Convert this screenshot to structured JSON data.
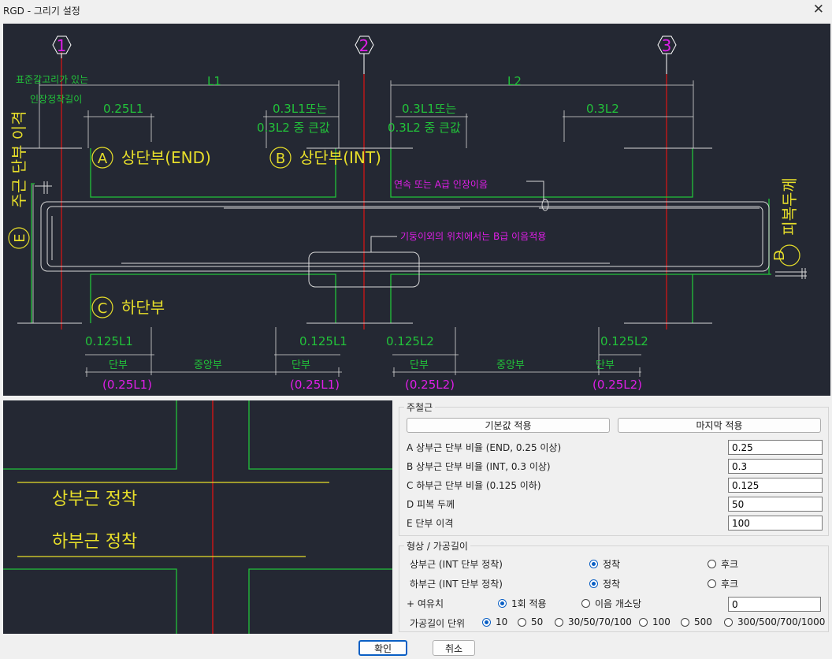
{
  "window": {
    "title": "RGD - 그리기 설정",
    "close_glyph": "✕"
  },
  "top_diagram": {
    "gridlines": [
      "1",
      "2",
      "3"
    ],
    "note_hook_1": "표준갈고리가 있는",
    "note_hook_2": "인장정착길이",
    "span_1": "L1",
    "span_2": "L2",
    "dim_025L1": "0.25L1",
    "dim_03L1_or": "0.3L1또는",
    "dim_03L2_larger": "0.3L2 중 큰값",
    "dim_03L1_or_b": "0.3L1또는",
    "dim_03L2_larger_b": "0.3L2 중 큰값",
    "dim_03L2": "0.3L2",
    "label_A_letter": "A",
    "label_A": "상단부(END)",
    "label_B_letter": "B",
    "label_B": "상단부(INT)",
    "label_C_letter": "C",
    "label_C": "하단부",
    "label_D_letter": "D",
    "label_D": "피복두께",
    "label_E_letter": "E",
    "label_E": "주근 단부 이격",
    "splice_note_1": "연속 또는 A급 인장이음",
    "splice_note_2": "기둥이외의 위치에서는 B급 이음적용",
    "bottom_dims": [
      "0.125L1",
      "0.125L1",
      "0.125L2",
      "0.125L2"
    ],
    "zone_end": "단부",
    "zone_center": "중앙부",
    "paren_dims": [
      "(0.25L1)",
      "(0.25L1)",
      "(0.25L2)",
      "(0.25L2)"
    ]
  },
  "bottom_diagram": {
    "top_anchor": "상부근 정착",
    "bottom_anchor": "하부근 정착"
  },
  "main_bar": {
    "legend": "주철근",
    "btn_default": "기본값 적용",
    "btn_last": "마지막 적용",
    "rows": [
      {
        "label": "A 상부근 단부 비율 (END, 0.25 이상)",
        "value": "0.25"
      },
      {
        "label": "B 상부근 단부 비율 (INT, 0.3 이상)",
        "value": "0.3"
      },
      {
        "label": "C 하부근 단부 비율 (0.125 이하)",
        "value": "0.125"
      },
      {
        "label": "D 피복 두께",
        "value": "50"
      },
      {
        "label": "E 단부 이격",
        "value": "100"
      }
    ]
  },
  "shape": {
    "legend": "형상 / 가공길이",
    "top_bar_label": "상부근 (INT 단부 정착)",
    "bottom_bar_label": "하부근 (INT 단부 정착)",
    "opt_anchor": "정착",
    "opt_hook": "후크",
    "allowance_label": "+ 여유치",
    "opt_once": "1회 적용",
    "opt_per_splice": "이음 개소당",
    "allowance_value": "0",
    "unit_label": "가공길이 단위",
    "units": [
      "10",
      "50",
      "30/50/70/100",
      "100",
      "500",
      "300/500/700/1000"
    ],
    "selected": {
      "top_bar": "정착",
      "bottom_bar": "정착",
      "allowance": "1회 적용",
      "unit": "10"
    }
  },
  "buttons": {
    "ok": "확인",
    "cancel": "취소"
  },
  "colors": {
    "cad_bg": "#242833",
    "green": "#22c33a",
    "magenta": "#e01ee8",
    "yellow": "#e8df2a",
    "red": "#d11515",
    "white": "#d8d8d8",
    "accent": "#0a5fc4"
  }
}
